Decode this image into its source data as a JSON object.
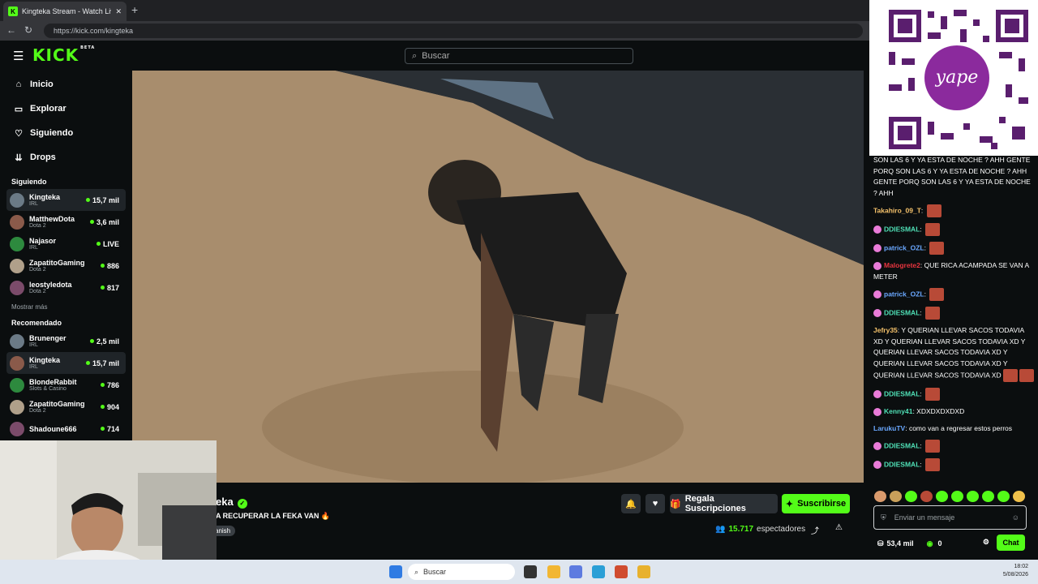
{
  "browser": {
    "tab_title": "Kingteka Stream - Watch Live",
    "url": "https://kick.com/kingteka"
  },
  "header": {
    "logo": "KICK",
    "logo_badge": "BETA",
    "search_placeholder": "Buscar"
  },
  "sidebar": {
    "nav": [
      {
        "label": "Inicio",
        "icon": "home-icon"
      },
      {
        "label": "Explorar",
        "icon": "compass-icon"
      },
      {
        "label": "Siguiendo",
        "icon": "heart-icon"
      },
      {
        "label": "Drops",
        "icon": "drops-icon"
      }
    ],
    "following_heading": "Siguiendo",
    "following": [
      {
        "name": "Kingteka",
        "category": "IRL",
        "viewers": "15,7 mil",
        "active": true
      },
      {
        "name": "MatthewDota",
        "category": "Dota 2",
        "viewers": "3,6 mil"
      },
      {
        "name": "Najasor",
        "category": "IRL",
        "viewers": "LIVE"
      },
      {
        "name": "ZapatitoGaming",
        "category": "Dota 2",
        "viewers": "886"
      },
      {
        "name": "leostyledota",
        "category": "Dota 2",
        "viewers": "817"
      }
    ],
    "show_more": "Mostrar más",
    "recommended_heading": "Recomendado",
    "recommended": [
      {
        "name": "Brunenger",
        "category": "IRL",
        "viewers": "2,5 mil"
      },
      {
        "name": "Kingteka",
        "category": "IRL",
        "viewers": "15,7 mil",
        "active": true
      },
      {
        "name": "BlondeRabbit",
        "category": "Slots & Casino",
        "viewers": "786"
      },
      {
        "name": "ZapatitoGaming",
        "category": "Dota 2",
        "viewers": "904"
      },
      {
        "name": "Shadoune666",
        "category": "",
        "viewers": "714"
      }
    ]
  },
  "stream": {
    "streamer": "eka",
    "title": "A RECUPERAR LA FEKA VAN 🔥",
    "language": "anish",
    "gift_label": "Regala Suscripciones",
    "subscribe_label": "Suscribirse",
    "viewers_count": "15.717",
    "viewers_label": "espectadores"
  },
  "chat": {
    "messages": [
      {
        "user": "",
        "text": "SON LAS 6 Y YA ESTA DE NOCHE ? AHH GENTE PORQ SON LAS 6 Y YA ESTA DE NOCHE ? AHH GENTE PORQ SON LAS 6 Y YA ESTA DE NOCHE ? AHH",
        "color": "#ffffff",
        "badge": false,
        "emotes": 0
      },
      {
        "user": "Takahiro_09_T",
        "text": "",
        "color": "#f5c26b",
        "badge": false,
        "emotes": 1
      },
      {
        "user": "DDIESMAL",
        "text": "",
        "color": "#4fe0b6",
        "badge": true,
        "emotes": 1
      },
      {
        "user": "patrick_OZL",
        "text": "",
        "color": "#6aa8ff",
        "badge": true,
        "emotes": 1
      },
      {
        "user": "Malogrete2",
        "text": "QUE RICA ACAMPADA SE VAN A METER",
        "color": "#e8353f",
        "badge": true,
        "emotes": 0
      },
      {
        "user": "patrick_OZL",
        "text": "",
        "color": "#6aa8ff",
        "badge": true,
        "emotes": 1
      },
      {
        "user": "DDIESMAL",
        "text": "",
        "color": "#4fe0b6",
        "badge": true,
        "emotes": 1
      },
      {
        "user": "Jefry35",
        "text": "Y QUERIAN LLEVAR SACOS TODAVIA XD Y QUERIAN LLEVAR SACOS TODAVIA XD Y QUERIAN LLEVAR SACOS TODAVIA XD Y QUERIAN LLEVAR SACOS TODAVIA XD Y QUERIAN LLEVAR SACOS TODAVIA XD",
        "color": "#f5c26b",
        "badge": false,
        "emotes": 2
      },
      {
        "user": "DDIESMAL",
        "text": "",
        "color": "#4fe0b6",
        "badge": true,
        "emotes": 1
      },
      {
        "user": "Kenny41",
        "text": "XDXDXDXDXD",
        "color": "#4fe0b6",
        "badge": true,
        "emotes": 0
      },
      {
        "user": "LarukuTV",
        "text": "como van a regresar estos perros",
        "color": "#6aa8ff",
        "badge": false,
        "emotes": 0
      },
      {
        "user": "DDIESMAL",
        "text": "",
        "color": "#4fe0b6",
        "badge": true,
        "emotes": 1
      },
      {
        "user": "DDIESMAL",
        "text": "",
        "color": "#4fe0b6",
        "badge": true,
        "emotes": 1
      }
    ],
    "input_placeholder": "Enviar un mensaje",
    "points": "53,4 mil",
    "kick_points": "0",
    "chat_button": "Chat"
  },
  "taskbar": {
    "search_placeholder": "Buscar",
    "time": "18:02",
    "date": "5/08/2026"
  }
}
